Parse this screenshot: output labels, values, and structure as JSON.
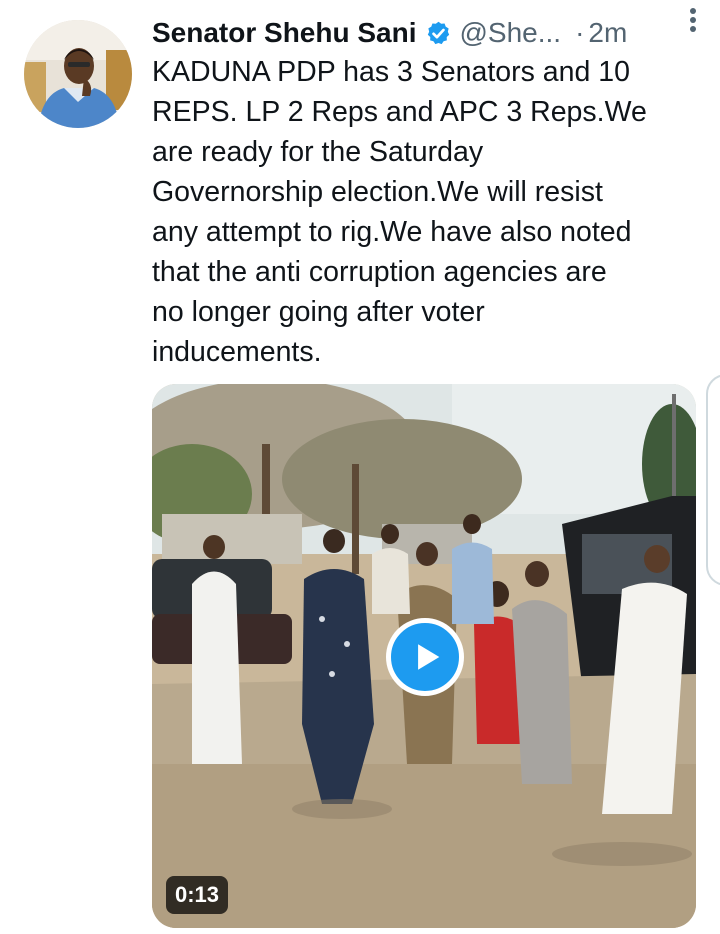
{
  "tweet": {
    "author_name": "Senator Shehu Sani",
    "handle": "@She...",
    "separator": "·",
    "time": "2m",
    "text": "KADUNA PDP has 3 Senators and 10\nREPS. LP 2 Reps and APC 3 Reps.We\nare ready for the Saturday\nGovernorship election.We will resist\nany attempt to rig.We have also noted\nthat the anti corruption agencies are\nno longer going after voter\ninducements.",
    "verified_icon": "verified-badge-icon",
    "more_icon": "more-vertical-icon"
  },
  "media": {
    "type": "video",
    "duration": "0:13",
    "play_icon": "play-icon"
  },
  "colors": {
    "accent": "#1d9bf0",
    "text": "#0f1419",
    "secondary": "#536471"
  }
}
